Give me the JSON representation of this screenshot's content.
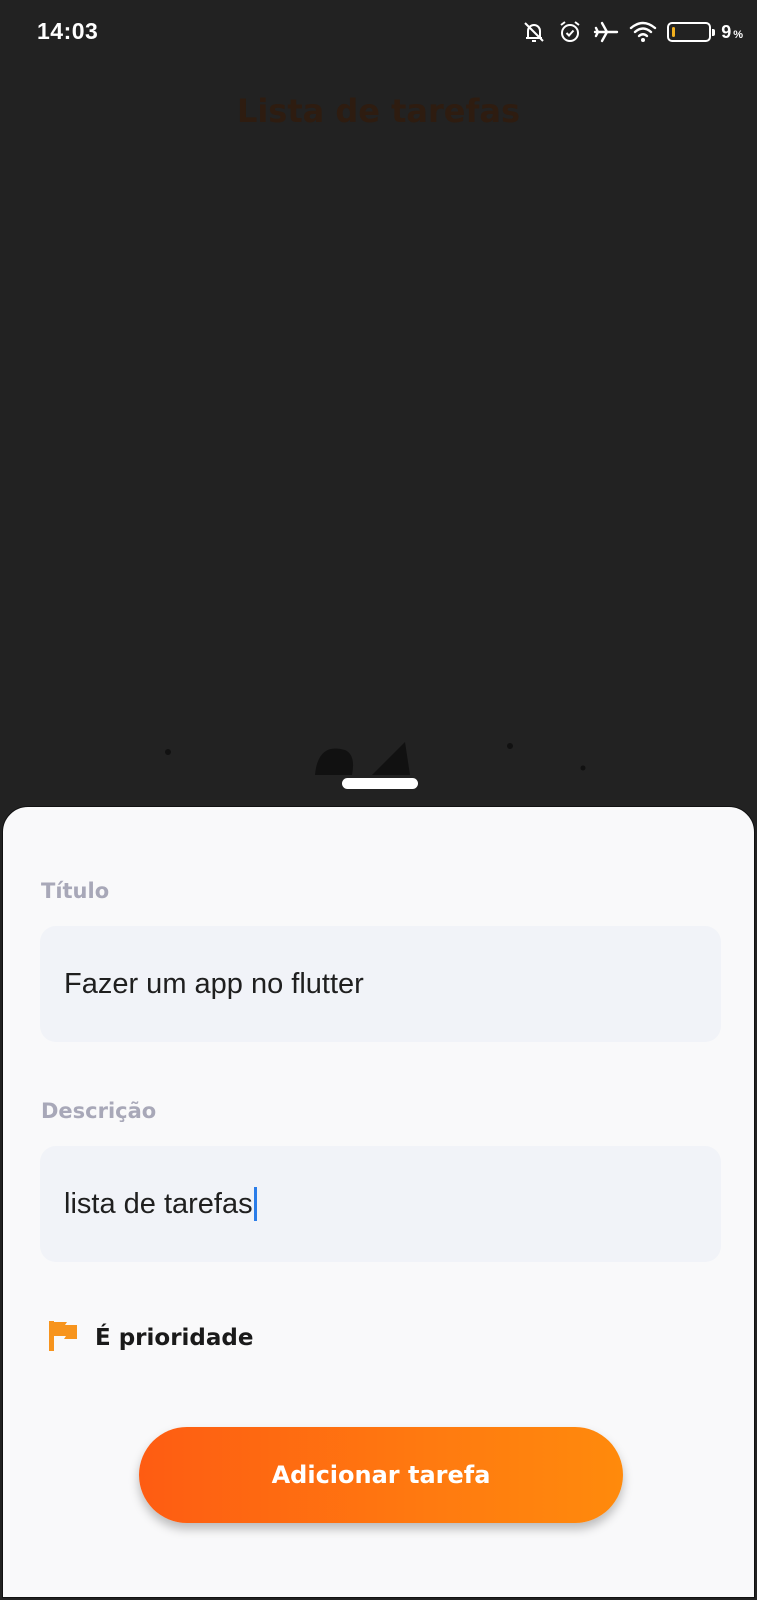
{
  "status_bar": {
    "time": "14:03",
    "battery_level": "9",
    "battery_unit": "%",
    "battery_fraction": 0.09,
    "icons": [
      "bell-muted-icon",
      "alarm-icon",
      "airplane-icon",
      "wifi-icon",
      "battery-icon"
    ]
  },
  "app": {
    "title": "Lista de tarefas"
  },
  "sheet": {
    "title_label": "Título",
    "title_value": "Fazer um app no flutter",
    "description_label": "Descrição",
    "description_value": "lista de tarefas",
    "priority_label": "É prioridade",
    "priority_icon": "flag-icon",
    "submit_label": "Adicionar tarefa"
  },
  "colors": {
    "accent": "#FE5C12",
    "accent_end": "#FF8A0C",
    "flag": "#F7941D",
    "background": "#222222",
    "sheet": "#F9F9FA",
    "field": "#F1F3F8",
    "label": "#A8A8B8",
    "cursor": "#2B7DE9"
  }
}
